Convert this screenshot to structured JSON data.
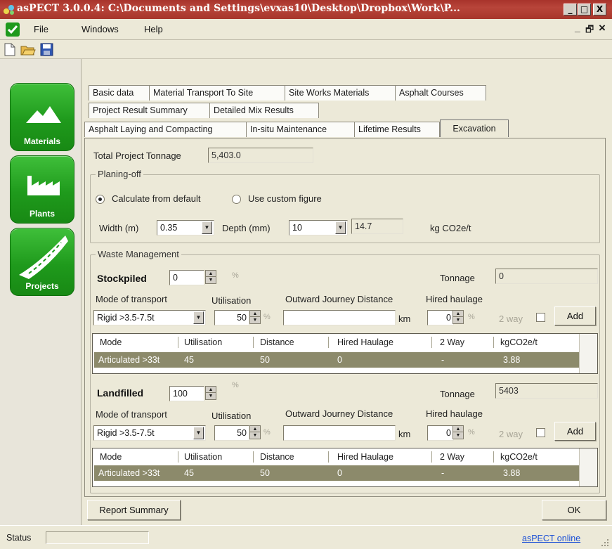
{
  "window": {
    "title": "asPECT 3.0.0.4: C:\\Documents and Settings\\evxas10\\Desktop\\Dropbox\\Work\\P...",
    "minimize_glyph": "_",
    "maximize_glyph": "□",
    "close_glyph": "X"
  },
  "menu": {
    "items": [
      "File",
      "Windows",
      "Help"
    ],
    "right_minimize": "_",
    "right_restore": "🗗",
    "right_close": "×"
  },
  "toolbar": {
    "icons": [
      "new-document-icon",
      "open-folder-icon",
      "save-disk-icon"
    ]
  },
  "nav": {
    "buttons": [
      {
        "label": "Materials",
        "icon": "mountains-icon"
      },
      {
        "label": "Plants",
        "icon": "factory-icon"
      },
      {
        "label": "Projects",
        "icon": "road-icon"
      }
    ]
  },
  "tabs": {
    "row1": [
      "Basic data",
      "Material Transport To Site",
      "Site Works Materials",
      "Asphalt Courses"
    ],
    "row2": [
      "Project Result Summary",
      "Detailed Mix Results"
    ],
    "row3": [
      "Asphalt Laying and Compacting",
      "In-situ Maintenance",
      "Lifetime Results",
      "Excavation"
    ],
    "active": "Excavation"
  },
  "excavation": {
    "total_tonnage_label": "Total Project Tonnage",
    "total_tonnage_value": "5,403.0",
    "planing": {
      "title": "Planing-off",
      "radio_default": "Calculate from default",
      "radio_custom": "Use custom figure",
      "selected": "default",
      "width_label": "Width (m)",
      "width_value": "0.35",
      "depth_label": "Depth (mm)",
      "depth_value": "10",
      "result_value": "14.7",
      "result_unit": "kg CO2e/t"
    },
    "waste": {
      "title": "Waste Management",
      "stockpiled": {
        "label": "Stockpiled",
        "percent": "0",
        "percent_unit": "%",
        "tonnage_label": "Tonnage",
        "tonnage_value": "0",
        "mode_label": "Mode of transport",
        "mode_value": "Rigid >3.5-7.5t",
        "util_label": "Utilisation",
        "util_value": "50",
        "util_unit": "%",
        "distance_label": "Outward Journey Distance",
        "distance_value": "",
        "distance_unit": "km",
        "hired_label": "Hired haulage",
        "hired_value": "0",
        "hired_unit": "%",
        "twoway_label": "2 way",
        "add_label": "Add",
        "grid": {
          "headers": [
            "Mode",
            "Utilisation",
            "Distance",
            "Hired Haulage",
            "2 Way",
            "kgCO2e/t"
          ],
          "rows": [
            [
              "Articulated >33t",
              "45",
              "50",
              "0",
              "-",
              "3.88"
            ]
          ]
        }
      },
      "landfilled": {
        "label": "Landfilled",
        "percent": "100",
        "percent_unit": "%",
        "tonnage_label": "Tonnage",
        "tonnage_value": "5403",
        "mode_label": "Mode of transport",
        "mode_value": "Rigid >3.5-7.5t",
        "util_label": "Utilisation",
        "util_value": "50",
        "util_unit": "%",
        "distance_label": "Outward Journey Distance",
        "distance_value": "",
        "distance_unit": "km",
        "hired_label": "Hired haulage",
        "hired_value": "0",
        "hired_unit": "%",
        "twoway_label": "2 way",
        "add_label": "Add",
        "grid": {
          "headers": [
            "Mode",
            "Utilisation",
            "Distance",
            "Hired Haulage",
            "2 Way",
            "kgCO2e/t"
          ],
          "rows": [
            [
              "Articulated >33t",
              "45",
              "50",
              "0",
              "-",
              "3.88"
            ]
          ]
        }
      }
    }
  },
  "footer": {
    "report_label": "Report Summary",
    "ok_label": "OK"
  },
  "status": {
    "label": "Status",
    "link": "asPECT online"
  },
  "colors": {
    "title_bar": "#a8332b",
    "nav_green": "#1f9a1c",
    "grid_row": "#8c8a6b",
    "link": "#1a4fd6"
  }
}
